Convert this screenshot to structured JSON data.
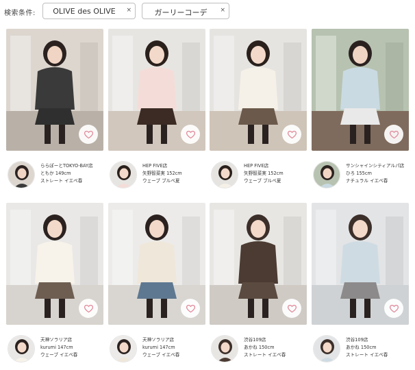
{
  "filter": {
    "label": "検索条件:",
    "chips": [
      {
        "text": "OLIVE des OLIVE",
        "remove": "×"
      },
      {
        "text": "ガーリーコーデ",
        "remove": "×"
      }
    ]
  },
  "cards": [
    {
      "shop": "ららぽーとTOKYO-BAY店",
      "name": "ともか 149cm",
      "type": "ストレート イエベ春",
      "photo": {
        "bg": "#dcd6cf",
        "floor": "#b9b1a8",
        "top": "#3a3a3a",
        "bottom": "#2f2f2f",
        "hair": "#2b2220",
        "skin": "#f1d5c4"
      }
    },
    {
      "shop": "HEP FIVE店",
      "name": "矢野智菜実 152cm",
      "type": "ウェーブ ブルベ夏",
      "photo": {
        "bg": "#e7e5e2",
        "floor": "#d1c7bc",
        "top": "#f4ddd8",
        "bottom": "#3b2b24",
        "hair": "#2a201c",
        "skin": "#f3d9c9"
      }
    },
    {
      "shop": "HEP FIVE店",
      "name": "矢野智菜実 152cm",
      "type": "ウェーブ ブルベ夏",
      "photo": {
        "bg": "#e6e4e1",
        "floor": "#cfc4b8",
        "top": "#f6f1e8",
        "bottom": "#6b5a4c",
        "hair": "#2a201c",
        "skin": "#f3d9c9"
      }
    },
    {
      "shop": "サンシャインシティアルパ店",
      "name": "ひろ 155cm",
      "type": "ナチュラル イエベ春",
      "photo": {
        "bg": "#b7c2b0",
        "floor": "#7f6b5d",
        "top": "#c9dae2",
        "bottom": "#e9e9e9",
        "hair": "#2b2220",
        "skin": "#f1d5c4"
      }
    },
    {
      "shop": "天神ソラリア店",
      "name": "kurumi 147cm",
      "type": "ウェーブ イエベ春",
      "photo": {
        "bg": "#e9e8e6",
        "floor": "#d7d3ce",
        "top": "#f7f3ea",
        "bottom": "#6e5e52",
        "hair": "#2b2220",
        "skin": "#f3d9c9"
      }
    },
    {
      "shop": "天神ソラリア店",
      "name": "kurumi 147cm",
      "type": "ウェーブ イエベ春",
      "photo": {
        "bg": "#ecebe9",
        "floor": "#d9d6d1",
        "top": "#efe7da",
        "bottom": "#5f7891",
        "hair": "#2b2220",
        "skin": "#f3d9c9"
      }
    },
    {
      "shop": "渋谷109店",
      "name": "あかね 150cm",
      "type": "ストレート イエベ春",
      "photo": {
        "bg": "#e8e6e3",
        "floor": "#cfcac4",
        "top": "#4b3b32",
        "bottom": "#5a4a40",
        "hair": "#3c2f2a",
        "skin": "#f3d9c9"
      }
    },
    {
      "shop": "渋谷109店",
      "name": "あかね 150cm",
      "type": "ストレート イエベ春",
      "photo": {
        "bg": "#e2e4e6",
        "floor": "#cfd2d4",
        "top": "#cfdbe3",
        "bottom": "#8c8a8a",
        "hair": "#3c2f2a",
        "skin": "#f3d9c9"
      }
    }
  ],
  "colors": {
    "heart": "#e2899a",
    "chip_border": "#bfbfbf"
  }
}
